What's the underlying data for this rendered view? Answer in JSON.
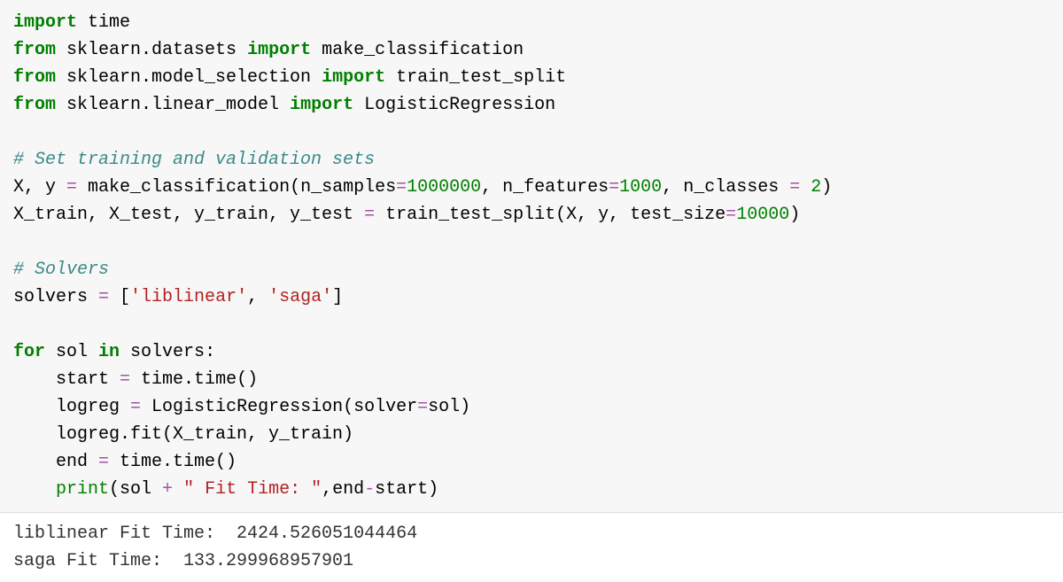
{
  "code": {
    "l1": {
      "kw1": "import",
      "m1": " time"
    },
    "l2": {
      "kw1": "from",
      "m1": " sklearn.datasets ",
      "kw2": "import",
      "m2": " make_classification"
    },
    "l3": {
      "kw1": "from",
      "m1": " sklearn.model_selection ",
      "kw2": "import",
      "m2": " train_test_split"
    },
    "l4": {
      "kw1": "from",
      "m1": " sklearn.linear_model ",
      "kw2": "import",
      "m2": " LogisticRegression"
    },
    "l6": {
      "cmt": "# Set training and validation sets"
    },
    "l7": {
      "a": "X, y ",
      "op1": "=",
      "b": " make_classification(n_samples",
      "op2": "=",
      "n1": "1000000",
      "c": ", n_features",
      "op3": "=",
      "n2": "1000",
      "d": ", n_classes ",
      "op4": "=",
      "sp": " ",
      "n3": "2",
      "e": ")"
    },
    "l8": {
      "a": "X_train, X_test, y_train, y_test ",
      "op1": "=",
      "b": " train_test_split(X, y, test_size",
      "op2": "=",
      "n1": "10000",
      "c": ")"
    },
    "l10": {
      "cmt": "# Solvers"
    },
    "l11": {
      "a": "solvers ",
      "op1": "=",
      "b": " [",
      "s1": "'liblinear'",
      "c": ", ",
      "s2": "'saga'",
      "d": "]"
    },
    "l13": {
      "kw1": "for",
      "a": " sol ",
      "kw2": "in",
      "b": " solvers:"
    },
    "l14": {
      "a": "    start ",
      "op1": "=",
      "b": " time.time()"
    },
    "l15": {
      "a": "    logreg ",
      "op1": "=",
      "b": " LogisticRegression(solver",
      "op2": "=",
      "c": "sol)"
    },
    "l16": {
      "a": "    logreg.fit(X_train, y_train)"
    },
    "l17": {
      "a": "    end ",
      "op1": "=",
      "b": " time.time()"
    },
    "l18": {
      "ind": "    ",
      "bi": "print",
      "a": "(sol ",
      "op1": "+",
      "sp": " ",
      "s1": "\" Fit Time: \"",
      "b": ",end",
      "op2": "-",
      "c": "start)"
    }
  },
  "output": {
    "l1": "liblinear Fit Time:  2424.526051044464",
    "l2": "saga Fit Time:  133.299968957901"
  }
}
